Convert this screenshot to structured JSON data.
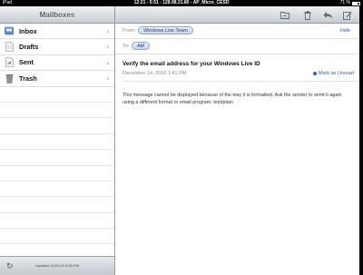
{
  "status_bar": {
    "device": "iPad",
    "center_text": "12:21 - 5:51 - 128.98.31.80 - AP_Micro_CESD",
    "battery": "71 %",
    "battery_level": 0.71
  },
  "sidebar": {
    "title": "Mailboxes",
    "items": [
      {
        "label": "Inbox",
        "icon": "inbox-icon"
      },
      {
        "label": "Drafts",
        "icon": "drafts-icon"
      },
      {
        "label": "Sent",
        "icon": "sent-icon"
      },
      {
        "label": "Trash",
        "icon": "trash-icon"
      }
    ],
    "chevron": "›",
    "footer": {
      "refresh_icon": "↻",
      "updated_text": "Updated 12/21/10 5:58 PM"
    }
  },
  "toolbar": {
    "buttons": [
      "folder-icon",
      "trash-icon",
      "reply-icon",
      "compose-icon"
    ]
  },
  "message": {
    "from_label": "From:",
    "from_value": "Windows Live Team",
    "hide_label": "Hide",
    "to_label": "To:",
    "to_value": "Atif",
    "subject": "Verify the email address for your Windows Live ID",
    "date": "December 14, 2010 1:41 PM",
    "mark_unread_label": "Mark as Unread",
    "body": "This message cannot be displayed because of the way it is formatted. Ask the sender to send it again using a different format or email program. text/plain"
  }
}
